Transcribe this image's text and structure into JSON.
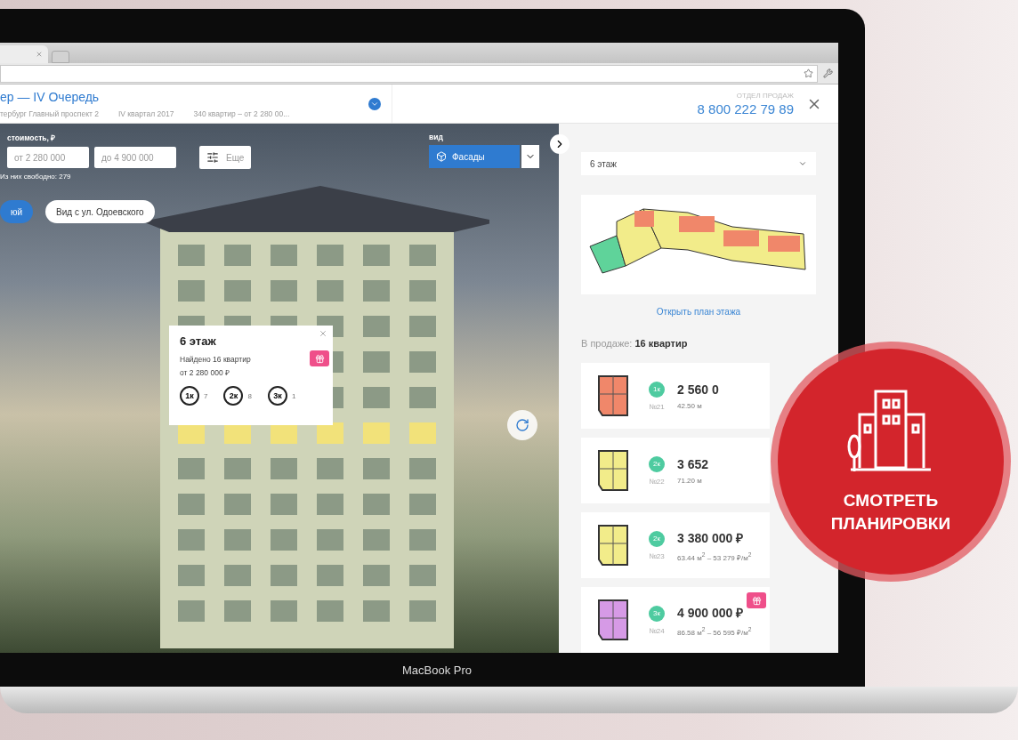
{
  "header": {
    "title": "ер — IV Очередь",
    "address": "тербург Главный проспект 2",
    "deadline": "IV квартал 2017",
    "summary": "340 квартир – от 2 280 00...",
    "sales_label": "ОТДЕЛ ПРОДАЖ",
    "phone": "8 800 222 79 89"
  },
  "filters": {
    "price_label": "стоимость, ₽",
    "price_from": {
      "placeholder": "от 2 280 000"
    },
    "price_to": {
      "placeholder": "до 4 900 000"
    },
    "more_button": "Еще",
    "free_count": "Из них свободно: 279",
    "view_label": "вид",
    "view_select": "Фасады"
  },
  "view_tabs": [
    {
      "label": "юй",
      "selected": true
    },
    {
      "label": "Вид с ул. Одоевского",
      "selected": false
    }
  ],
  "floor_popup": {
    "title": "6 этаж",
    "found": "Найдено 16 квартир",
    "price_from": "от 2 280 000 ₽",
    "has_gift": true,
    "room_counts": [
      {
        "rooms": "1к",
        "count": "7"
      },
      {
        "rooms": "2к",
        "count": "8"
      },
      {
        "rooms": "3к",
        "count": "1"
      }
    ]
  },
  "panel": {
    "floor_select": "6 этаж",
    "open_plan_link": "Открыть план этажа",
    "on_sale": "В продаже: **16 квартир**",
    "listings": [
      {
        "rooms": "1к",
        "number": "№21",
        "price": "2 560 0",
        "area": "42.50 м",
        "color": "#f0876a",
        "gift": false
      },
      {
        "rooms": "2к",
        "number": "№22",
        "price": "3 652",
        "area": "71.20 м",
        "color": "#f2ec8a",
        "gift": false
      },
      {
        "rooms": "2к",
        "number": "№23",
        "price": "3 380 000 ₽",
        "area": "63.44 м$^{2}$ – 53 279 ₽/м$^{2}$",
        "color": "#f2ec8a",
        "gift": false
      },
      {
        "rooms": "3к",
        "number": "№24",
        "price": "4 900 000 ₽",
        "area": "86.58 м$^{2}$ – 56 595 ₽/м$^{2}$",
        "color": "#d69ae6",
        "gift": true
      }
    ]
  },
  "laptop_label": "MacBook Pro",
  "promo": {
    "lines": [
      "СМОТРЕТЬ",
      "ПЛАНИРОВКИ"
    ]
  }
}
